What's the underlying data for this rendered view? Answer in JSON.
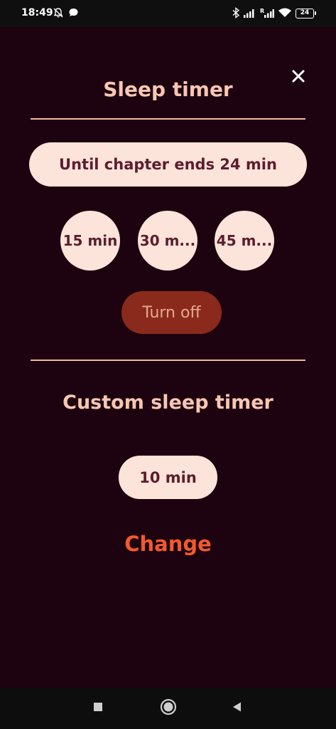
{
  "status_bar": {
    "time": "18:49",
    "battery": "24",
    "icons": [
      "bell-off-icon",
      "message-icon",
      "bluetooth-icon",
      "signal-icon",
      "signal-r-icon",
      "wifi-icon",
      "battery-icon"
    ]
  },
  "dialog": {
    "title": "Sleep timer",
    "close_icon": "close-icon",
    "chapter_option": "Until chapter ends 24 min",
    "presets": [
      "15 min",
      "30 m...",
      "45 m..."
    ],
    "turn_off": "Turn off",
    "custom_title": "Custom sleep timer",
    "custom_value": "10 min",
    "change": "Change"
  },
  "nav_bar": {
    "icons": [
      "recents-square-icon",
      "home-circle-icon",
      "back-triangle-icon"
    ]
  },
  "colors": {
    "background": "#1d020f",
    "title_text": "#f8c6b3",
    "pill_bg": "#fde4da",
    "pill_text": "#5c1d2e",
    "turn_off_bg": "#8a2a1c",
    "turn_off_text": "#e7a891",
    "accent": "#f05a2e"
  }
}
